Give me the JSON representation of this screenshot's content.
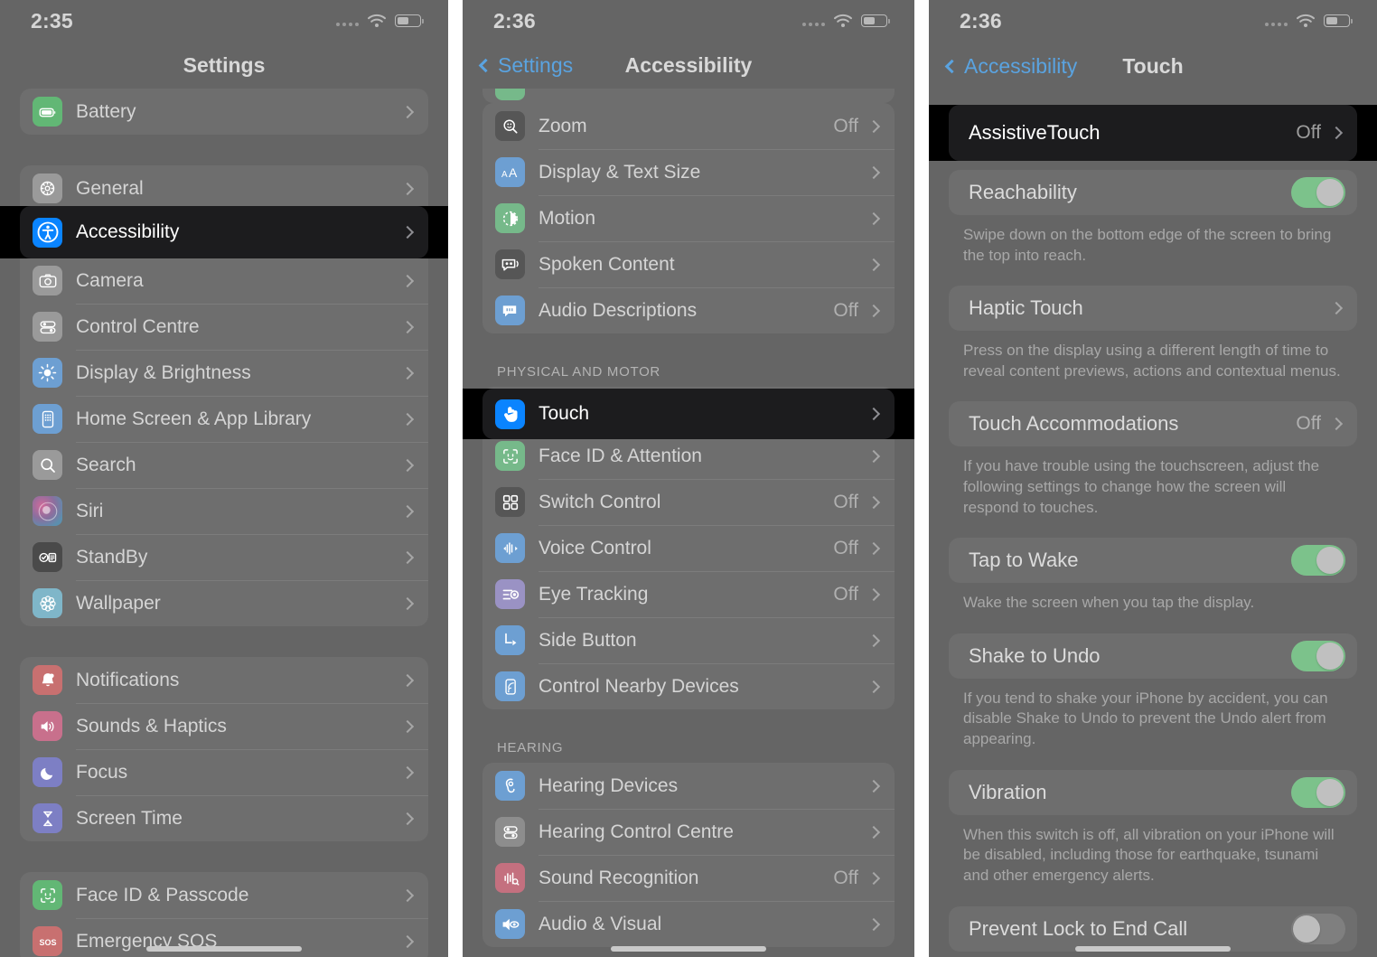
{
  "panels": [
    {
      "id": "settings",
      "status": {
        "time": "2:35",
        "wifi": "wifi-icon",
        "battery": "battery-icon",
        "cellular": "cellular-dots-icon"
      },
      "nav": {
        "title": "Settings",
        "back": null
      },
      "groups": [
        {
          "header": "",
          "rows": [
            {
              "label": "Battery",
              "value": "",
              "icon": "battery-app-icon",
              "color": "#62b775"
            }
          ]
        },
        {
          "header": "",
          "rows": [
            {
              "label": "General",
              "value": "",
              "icon": "gear-icon",
              "color": "#9a9a9a"
            },
            {
              "label": "Accessibility",
              "value": "",
              "icon": "accessibility-icon",
              "color": "#0a84ff",
              "highlighted": true
            },
            {
              "label": "Camera",
              "value": "",
              "icon": "camera-icon",
              "color": "#9a9a9a"
            },
            {
              "label": "Control Centre",
              "value": "",
              "icon": "control-centre-icon",
              "color": "#9a9a9a"
            },
            {
              "label": "Display & Brightness",
              "value": "",
              "icon": "brightness-icon",
              "color": "#6d9fd2"
            },
            {
              "label": "Home Screen & App Library",
              "value": "",
              "icon": "home-screen-icon",
              "color": "#6d9fd2"
            },
            {
              "label": "Search",
              "value": "",
              "icon": "search-icon",
              "color": "#9a9a9a"
            },
            {
              "label": "Siri",
              "value": "",
              "icon": "siri-icon",
              "color": "#8a6f9e"
            },
            {
              "label": "StandBy",
              "value": "",
              "icon": "standby-icon",
              "color": "#4a4a4a"
            },
            {
              "label": "Wallpaper",
              "value": "",
              "icon": "wallpaper-icon",
              "color": "#7fb6c9"
            }
          ]
        },
        {
          "header": "",
          "rows": [
            {
              "label": "Notifications",
              "value": "",
              "icon": "notifications-icon",
              "color": "#c87070"
            },
            {
              "label": "Sounds & Haptics",
              "value": "",
              "icon": "sounds-haptics-icon",
              "color": "#c8708c"
            },
            {
              "label": "Focus",
              "value": "",
              "icon": "focus-moon-icon",
              "color": "#7d7fc4"
            },
            {
              "label": "Screen Time",
              "value": "",
              "icon": "screen-time-icon",
              "color": "#7d7fc4"
            }
          ]
        },
        {
          "header": "",
          "rows": [
            {
              "label": "Face ID & Passcode",
              "value": "",
              "icon": "face-id-icon",
              "color": "#62b775"
            },
            {
              "label": "Emergency SOS",
              "value": "",
              "icon": "sos-icon",
              "color": "#c87070"
            }
          ]
        }
      ]
    },
    {
      "id": "accessibility",
      "status": {
        "time": "2:36",
        "wifi": "wifi-icon",
        "battery": "battery-icon",
        "cellular": "cellular-dots-icon"
      },
      "nav": {
        "title": "Accessibility",
        "back": "Settings"
      },
      "groups": [
        {
          "header": "",
          "rows": [
            {
              "label": "Zoom",
              "value": "Off",
              "icon": "zoom-magnifier-icon",
              "color": "#565656"
            },
            {
              "label": "Display & Text Size",
              "value": "",
              "icon": "display-text-size-icon",
              "color": "#6d9fd2"
            },
            {
              "label": "Motion",
              "value": "",
              "icon": "motion-icon",
              "color": "#76b98a"
            },
            {
              "label": "Spoken Content",
              "value": "",
              "icon": "spoken-content-icon",
              "color": "#565656"
            },
            {
              "label": "Audio Descriptions",
              "value": "Off",
              "icon": "audio-descriptions-icon",
              "color": "#6d9fd2"
            }
          ]
        },
        {
          "header": "PHYSICAL AND MOTOR",
          "rows": [
            {
              "label": "Touch",
              "value": "",
              "icon": "touch-hand-icon",
              "color": "#0a84ff",
              "highlighted": true
            },
            {
              "label": "Face ID & Attention",
              "value": "",
              "icon": "face-id-icon",
              "color": "#76b98a"
            },
            {
              "label": "Switch Control",
              "value": "Off",
              "icon": "switch-control-icon",
              "color": "#565656"
            },
            {
              "label": "Voice Control",
              "value": "Off",
              "icon": "voice-control-icon",
              "color": "#6d9fd2"
            },
            {
              "label": "Eye Tracking",
              "value": "Off",
              "icon": "eye-tracking-icon",
              "color": "#9a92c4"
            },
            {
              "label": "Side Button",
              "value": "",
              "icon": "side-button-icon",
              "color": "#6d9fd2"
            },
            {
              "label": "Control Nearby Devices",
              "value": "",
              "icon": "control-nearby-devices-icon",
              "color": "#6d9fd2"
            }
          ]
        },
        {
          "header": "HEARING",
          "rows": [
            {
              "label": "Hearing Devices",
              "value": "",
              "icon": "hearing-devices-icon",
              "color": "#6d9fd2"
            },
            {
              "label": "Hearing Control Centre",
              "value": "",
              "icon": "hearing-control-centre-icon",
              "color": "#8d8d8d"
            },
            {
              "label": "Sound Recognition",
              "value": "Off",
              "icon": "sound-recognition-icon",
              "color": "#c4707f"
            },
            {
              "label": "Audio & Visual",
              "value": "",
              "icon": "audio-visual-icon",
              "color": "#6d9fd2"
            }
          ]
        }
      ]
    },
    {
      "id": "touch",
      "status": {
        "time": "2:36",
        "wifi": "wifi-icon",
        "battery": "battery-icon",
        "cellular": "cellular-dots-icon"
      },
      "nav": {
        "title": "Touch",
        "back": "Accessibility"
      },
      "items": [
        {
          "type": "link",
          "label": "AssistiveTouch",
          "value": "Off",
          "highlighted": true
        },
        {
          "type": "toggle",
          "label": "Reachability",
          "on": true,
          "note": "Swipe down on the bottom edge of the screen to bring the top into reach."
        },
        {
          "type": "link",
          "label": "Haptic Touch",
          "value": "",
          "note": "Press on the display using a different length of time to reveal content previews, actions and contextual menus."
        },
        {
          "type": "link",
          "label": "Touch Accommodations",
          "value": "Off",
          "note": "If you have trouble using the touchscreen, adjust the following settings to change how the screen will respond to touches."
        },
        {
          "type": "toggle",
          "label": "Tap to Wake",
          "on": true,
          "note": "Wake the screen when you tap the display."
        },
        {
          "type": "toggle",
          "label": "Shake to Undo",
          "on": true,
          "note": "If you tend to shake your iPhone by accident, you can disable Shake to Undo to prevent the Undo alert from appearing."
        },
        {
          "type": "toggle",
          "label": "Vibration",
          "on": true,
          "note": "When this switch is off, all vibration on your iPhone will be disabled, including those for earthquake, tsunami and other emergency alerts."
        },
        {
          "type": "toggle",
          "label": "Prevent Lock to End Call",
          "on": false,
          "note": ""
        }
      ]
    }
  ],
  "colors": {
    "accent_blue": "#0a84ff",
    "toggle_on": "#7cc28b",
    "toggle_off": "#7f7f7f",
    "highlight_band": "#000000",
    "highlight_row": "#1c1c1e",
    "card": "#6e6e6e",
    "background": "#656565"
  }
}
